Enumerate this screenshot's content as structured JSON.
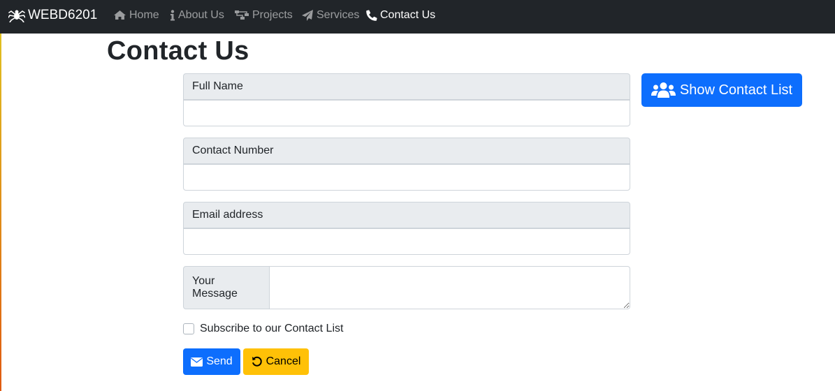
{
  "navbar": {
    "brand": "WEBD6201",
    "items": [
      {
        "label": "Home",
        "icon": "home-icon"
      },
      {
        "label": "About Us",
        "icon": "info-icon"
      },
      {
        "label": "Projects",
        "icon": "sitemap-icon"
      },
      {
        "label": "Services",
        "icon": "paper-plane-icon"
      },
      {
        "label": "Contact Us",
        "icon": "phone-icon",
        "active": true
      }
    ]
  },
  "page": {
    "title": "Contact Us"
  },
  "form": {
    "full_name_label": "Full Name",
    "full_name_value": "",
    "contact_number_label": "Contact Number",
    "contact_number_value": "",
    "email_label": "Email address",
    "email_value": "",
    "message_label": "Your Message",
    "message_value": "",
    "subscribe_label": "Subscribe to our Contact List",
    "subscribe_checked": false,
    "send_label": "Send",
    "cancel_label": "Cancel"
  },
  "sidebar": {
    "show_contact_list_label": "Show Contact List"
  },
  "colors": {
    "navbar_bg": "#212529",
    "primary": "#0d6efd",
    "warning": "#ffc107",
    "addon_bg": "#e9ecef"
  }
}
